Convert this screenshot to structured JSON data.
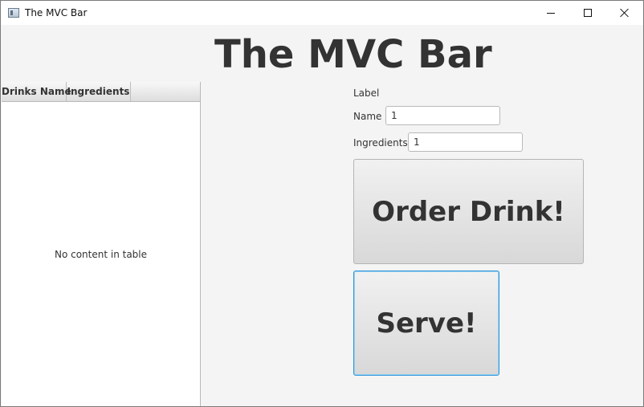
{
  "window": {
    "title": "The MVC Bar",
    "controls": {
      "minimize_icon": "minimize-icon",
      "maximize_icon": "maximize-icon",
      "close_icon": "close-icon"
    }
  },
  "main": {
    "heading": "The MVC Bar",
    "table": {
      "columns": [
        "Drinks Name",
        "Ingredients"
      ],
      "empty_message": "No content in table"
    },
    "form": {
      "caption": "Label",
      "name_label": "Name",
      "name_value": "1",
      "ingredients_label": "Ingredients",
      "ingredients_value": "1"
    },
    "buttons": {
      "order_label": "Order Drink!",
      "serve_label": "Serve!"
    }
  },
  "colors": {
    "window_background": "#f4f4f4",
    "focused_button_border": "#2a93d8"
  }
}
